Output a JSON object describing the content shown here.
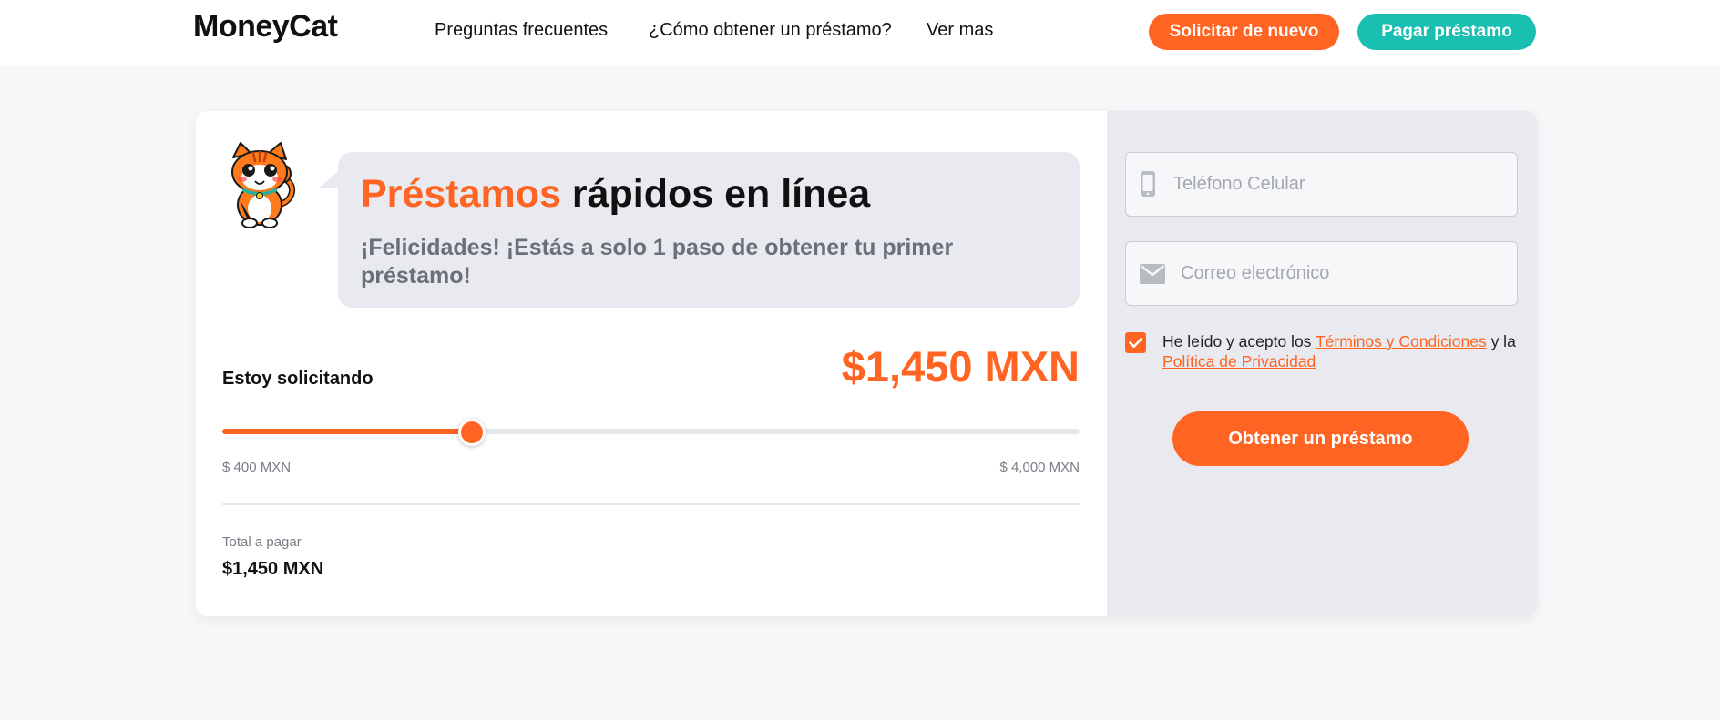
{
  "colors": {
    "brand_orange": "#ff6422",
    "brand_teal": "#19bfb1",
    "bubble_bg": "#e8eaef",
    "page_bg": "#f6f7f9"
  },
  "header": {
    "logo": "MoneyCat",
    "nav": [
      {
        "label": "Preguntas frecuentes"
      },
      {
        "label": "¿Cómo obtener un préstamo?"
      },
      {
        "label": "Ver mas"
      }
    ],
    "reapply_label": "Solicitar de nuevo",
    "pay_label": "Pagar préstamo"
  },
  "hero": {
    "mascot_icon": "cat-mascot-icon",
    "title_accent": "Préstamos",
    "title_rest": " rápidos en línea",
    "subtitle": "¡Felicidades! ¡Estás a solo 1 paso de obtener tu primer préstamo!"
  },
  "loan": {
    "requesting_label": "Estoy solicitando",
    "amount_display": "$1,450 MXN",
    "amount_value": 1450,
    "min_value": 400,
    "max_value": 4000,
    "min_label": "$ 400 MXN",
    "max_label": "$ 4,000 MXN",
    "total_label": "Total a pagar",
    "total_value": "$1,450 MXN"
  },
  "form": {
    "phone_placeholder": "Teléfono Celular",
    "phone_icon": "phone-icon",
    "email_placeholder": "Correo electrónico",
    "email_icon": "envelope-icon",
    "consent_checked": true,
    "consent_prefix": "He leído y acepto los ",
    "terms_link": "Términos y Condiciones",
    "consent_middle": " y la ",
    "privacy_link": "Política de Privacidad",
    "submit_label": "Obtener un préstamo"
  }
}
